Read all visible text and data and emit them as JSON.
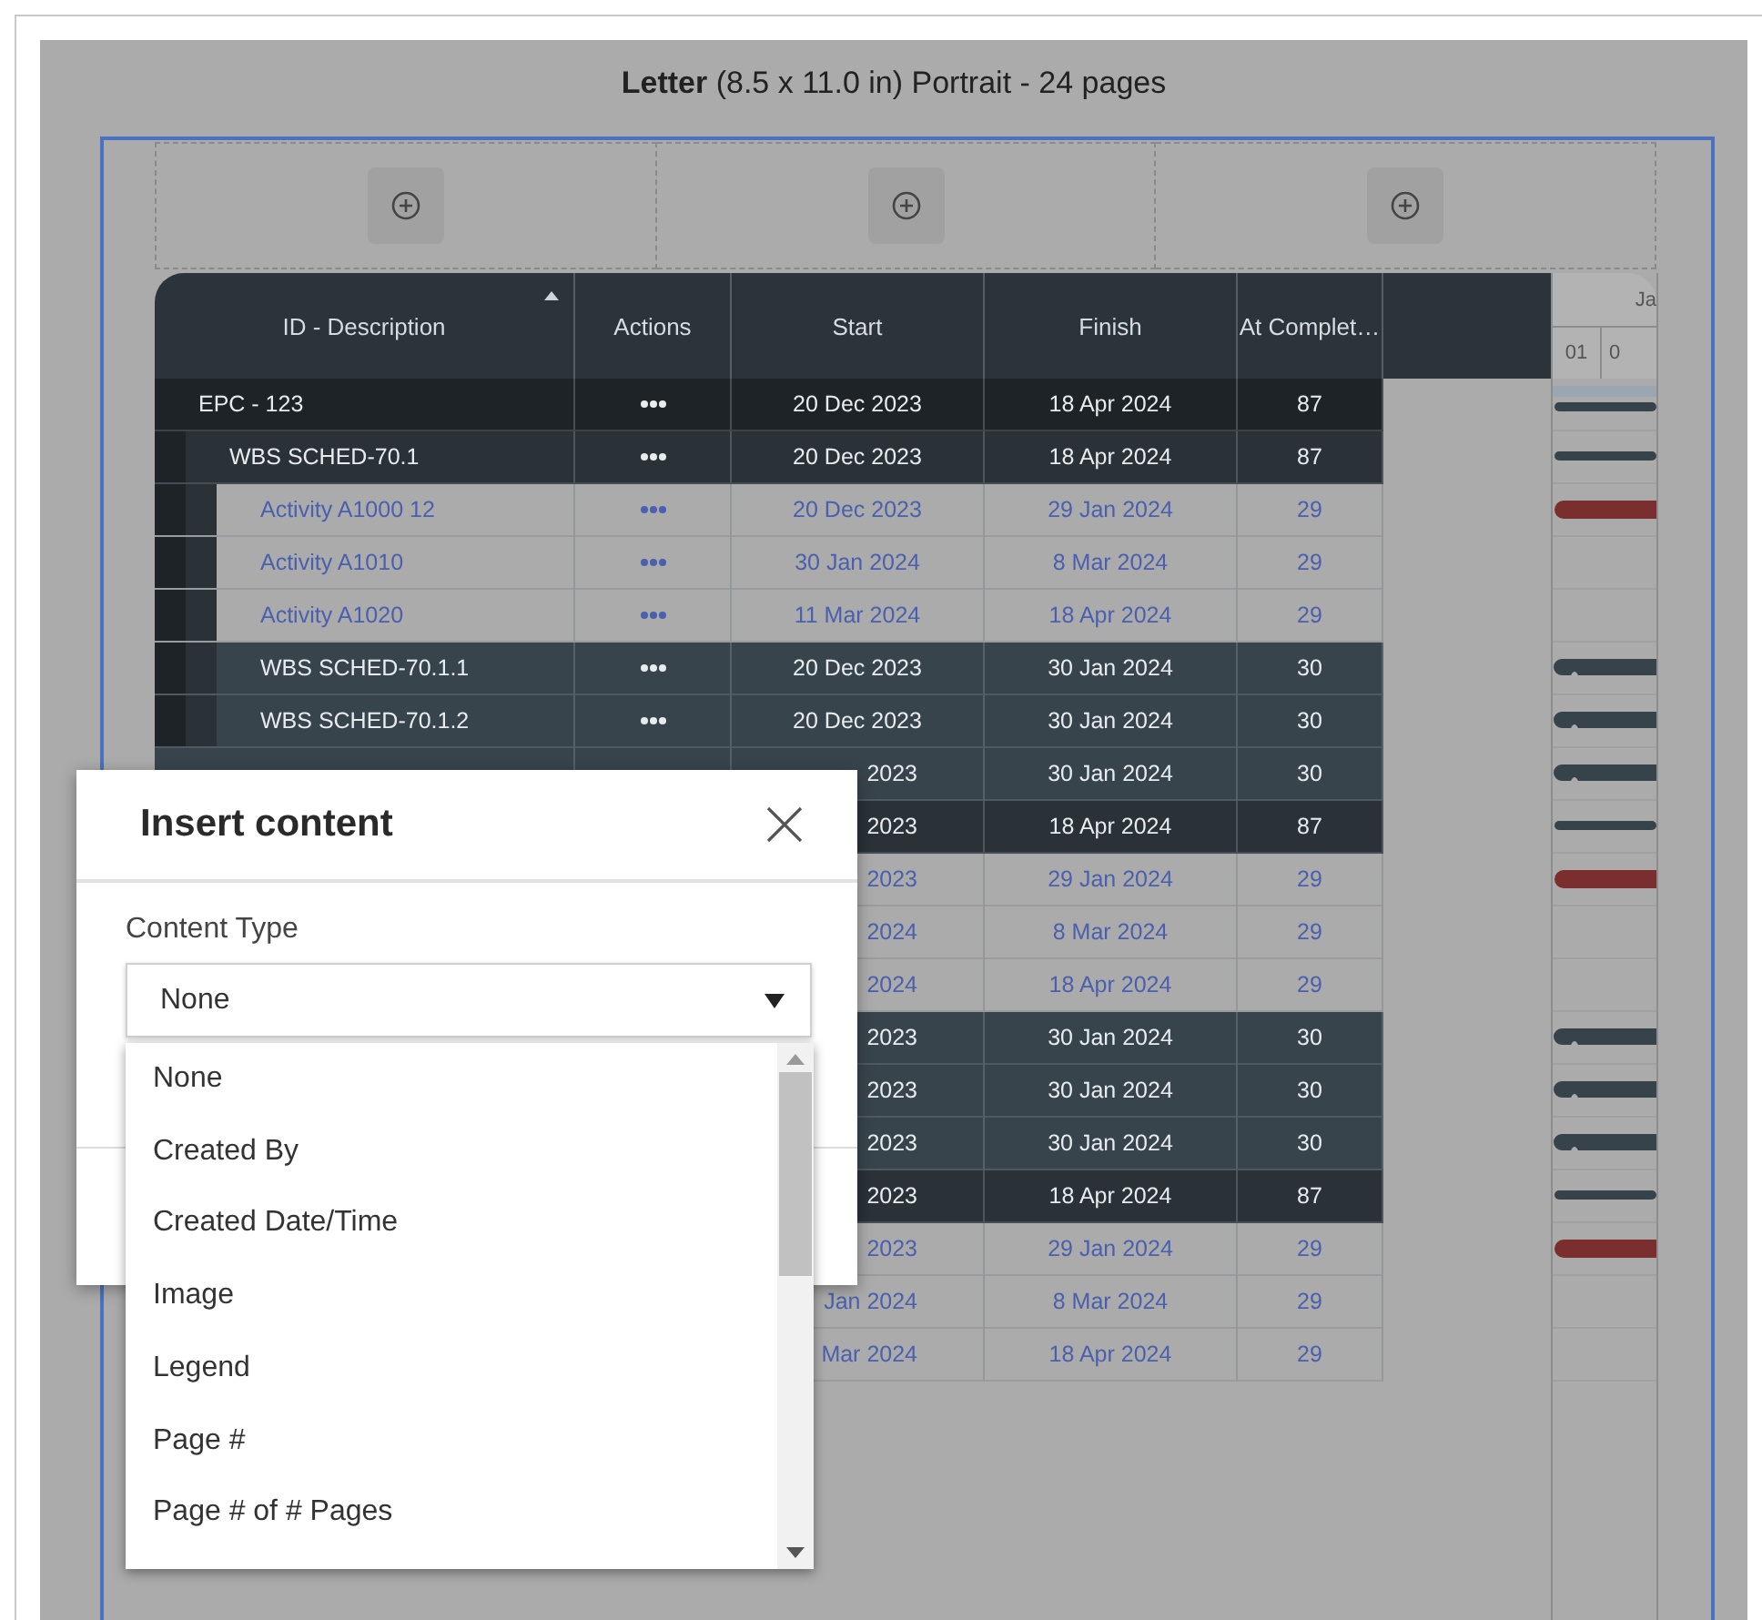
{
  "page_title": "**Letter** (8.5 x 11.0 in) Portrait - 24 pages",
  "header_slots": [
    {
      "kind": "add"
    },
    {
      "kind": "add"
    },
    {
      "kind": "add"
    }
  ],
  "table": {
    "columns": [
      {
        "label": "ID - Description",
        "sorted": true
      },
      {
        "label": "Actions",
        "sorted": false
      },
      {
        "label": "Start",
        "sorted": false
      },
      {
        "label": "Finish",
        "sorted": false
      },
      {
        "label": "At Complet…",
        "sorted": false
      }
    ],
    "gantt_header": {
      "month": "Ja",
      "days": [
        "01",
        "0"
      ]
    },
    "rows": [
      {
        "kind": "project",
        "id": "EPC - 123",
        "actions": true,
        "start": "20 Dec 2023",
        "finish": "18 Apr 2024",
        "at_completion": "87",
        "bar": {
          "kind": "project"
        }
      },
      {
        "kind": "wbs",
        "id": "WBS SCHED-70.1",
        "actions": true,
        "start": "20 Dec 2023",
        "finish": "18 Apr 2024",
        "at_completion": "87",
        "bar": {
          "kind": "summary"
        }
      },
      {
        "kind": "activity",
        "id": "Activity A1000 12",
        "actions": true,
        "start": "20 Dec 2023",
        "finish": "29 Jan 2024",
        "at_completion": "29",
        "bar": {
          "kind": "critical"
        }
      },
      {
        "kind": "activity",
        "id": "Activity A1010",
        "actions": true,
        "start": "30 Jan 2024",
        "finish": "8 Mar 2024",
        "at_completion": "29"
      },
      {
        "kind": "activity",
        "id": "Activity A1020",
        "actions": true,
        "start": "11 Mar 2024",
        "finish": "18 Apr 2024",
        "at_completion": "29"
      },
      {
        "kind": "wbs_sub",
        "id": "WBS SCHED-70.1.1",
        "actions": true,
        "start": "20 Dec 2023",
        "finish": "30 Jan 2024",
        "at_completion": "30",
        "bar": {
          "kind": "segment"
        }
      },
      {
        "kind": "wbs_sub",
        "id": "WBS SCHED-70.1.2",
        "actions": true,
        "start": "20 Dec 2023",
        "finish": "30 Jan 2024",
        "at_completion": "30",
        "bar": {
          "kind": "segment"
        }
      },
      {
        "kind": "wbs_sub",
        "start_tail": "2023",
        "finish": "30 Jan 2024",
        "at_completion": "30",
        "bar": {
          "kind": "segment"
        }
      },
      {
        "kind": "wbs",
        "start_tail": "2023",
        "finish": "18 Apr 2024",
        "at_completion": "87",
        "bar": {
          "kind": "summary"
        }
      },
      {
        "kind": "activity",
        "start_tail": "2023",
        "finish": "29 Jan 2024",
        "at_completion": "29",
        "bar": {
          "kind": "critical"
        }
      },
      {
        "kind": "activity",
        "start_tail": "2024",
        "finish": "8 Mar 2024",
        "at_completion": "29"
      },
      {
        "kind": "activity",
        "start_tail": "2024",
        "finish": "18 Apr 2024",
        "at_completion": "29"
      },
      {
        "kind": "wbs_sub",
        "start_tail": "2023",
        "finish": "30 Jan 2024",
        "at_completion": "30",
        "bar": {
          "kind": "segment"
        }
      },
      {
        "kind": "wbs_sub",
        "start_tail": "2023",
        "finish": "30 Jan 2024",
        "at_completion": "30",
        "bar": {
          "kind": "segment"
        }
      },
      {
        "kind": "wbs_sub",
        "start_tail": "2023",
        "finish": "30 Jan 2024",
        "at_completion": "30",
        "bar": {
          "kind": "segment"
        }
      },
      {
        "kind": "wbs",
        "start_tail": "2023",
        "finish": "18 Apr 2024",
        "at_completion": "87",
        "bar": {
          "kind": "summary"
        }
      },
      {
        "kind": "activity",
        "start_tail": "2023",
        "finish": "29 Jan 2024",
        "at_completion": "29",
        "bar": {
          "kind": "critical"
        }
      },
      {
        "kind": "activity",
        "start_tail": "Jan 2024",
        "finish": "8 Mar 2024",
        "at_completion": "29"
      },
      {
        "kind": "activity",
        "start_tail": "Mar 2024",
        "finish": "18 Apr 2024",
        "at_completion": "29"
      }
    ]
  },
  "dialog": {
    "title": "Insert content",
    "field_label": "Content Type",
    "value": "None",
    "options": [
      {
        "label": "None"
      },
      {
        "label": "Created By"
      },
      {
        "label": "Created Date/Time"
      },
      {
        "label": "Image"
      },
      {
        "label": "Legend"
      },
      {
        "label": "Page #"
      },
      {
        "label": "Page # of # Pages"
      }
    ]
  }
}
